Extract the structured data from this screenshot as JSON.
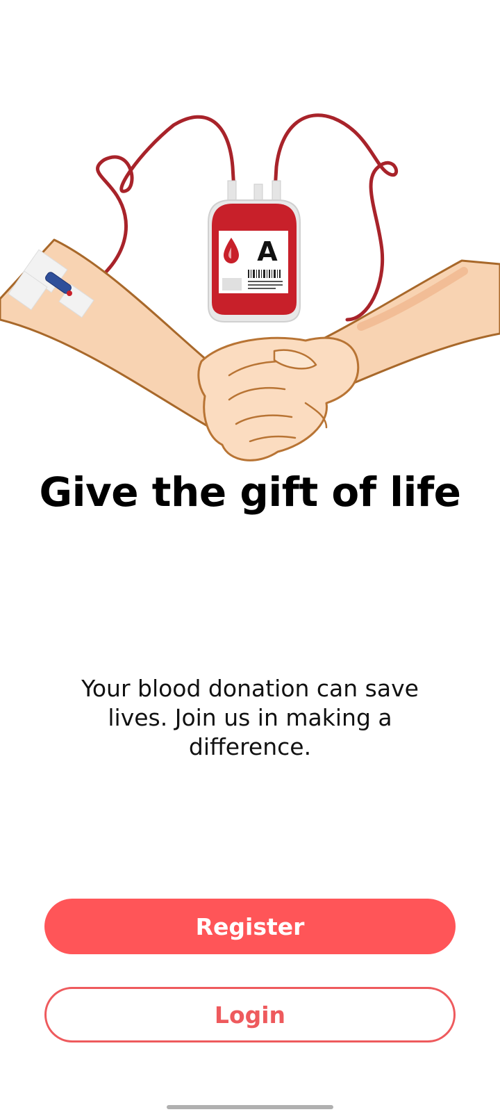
{
  "hero": {
    "title": "Give the gift of life",
    "subtitle": "Your blood donation can save lives. Join us in making a difference.",
    "blood_bag_label": "A"
  },
  "actions": {
    "register_label": "Register",
    "login_label": "Login"
  },
  "colors": {
    "primary": "#ff5558",
    "primary_outline": "#ee5a5d",
    "blood": "#c8202a",
    "skin": "#f8d3b2",
    "skin_outline": "#a8682a"
  }
}
